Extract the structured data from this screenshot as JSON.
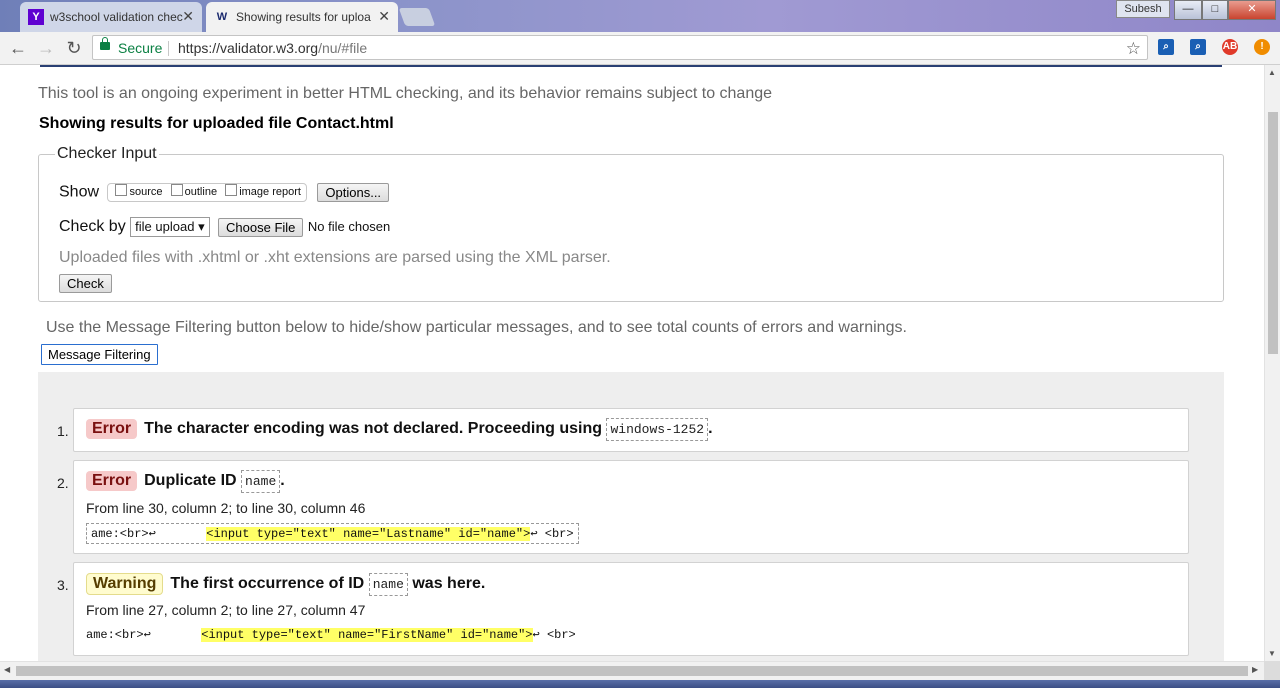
{
  "browser": {
    "tabs": [
      {
        "title": "w3school validation chec",
        "favicon": "yahoo-icon"
      },
      {
        "title": "Showing results for uploa",
        "favicon": "w3c-validator-icon"
      }
    ],
    "user": "Subesh",
    "window_controls": {
      "minimize": "—",
      "maximize": "□",
      "close": "✕"
    },
    "security_label": "Secure",
    "url_base": "https://validator.w3.org",
    "url_path": "/nu/#file"
  },
  "page": {
    "intro": "This tool is an ongoing experiment in better HTML checking, and its behavior remains subject to change",
    "showing": "Showing results for uploaded file Contact.html",
    "checker": {
      "legend": "Checker Input",
      "show_label": "Show",
      "show_options": [
        "source",
        "outline",
        "image report"
      ],
      "options_button": "Options...",
      "check_by_label": "Check by",
      "check_by_value": "file upload",
      "choose_file_button": "Choose File",
      "no_file": "No file chosen",
      "note": "Uploaded files with .xhtml or .xht extensions are parsed using the XML parser.",
      "check_button": "Check"
    },
    "filter_info": "Use the Message Filtering button below to hide/show particular messages, and to see total counts of errors and warnings.",
    "filter_button": "Message Filtering",
    "messages": [
      {
        "num": "1.",
        "type": "Error",
        "text": "The character encoding was not declared. Proceeding using",
        "code": "windows-1252",
        "suffix": "."
      },
      {
        "num": "2.",
        "type": "Error",
        "text": "Duplicate ID",
        "code": "name",
        "suffix": ".",
        "location": "From line 30, column 2; to line 30, column 46",
        "extract_pre": "ame:<br>↩       ",
        "extract_hl": "<input type=\"text\" name=\"Lastname\" id=\"name\">",
        "extract_post": "↩ <br>"
      },
      {
        "num": "3.",
        "type": "Warning",
        "text": "The first occurrence of ID",
        "code": "name",
        "suffix": "was here.",
        "location": "From line 27, column 2; to line 27, column 47",
        "extract_pre": "ame:<br>↩       ",
        "extract_hl": "<input type=\"text\" name=\"FirstName\" id=\"name\">",
        "extract_post": "↩ <br>"
      }
    ]
  },
  "colors": {
    "error_badge_bg": "#f6c9c9",
    "warning_badge_bg": "#fffccf",
    "highlight": "#ffff66",
    "secure_green": "#0b8043"
  }
}
